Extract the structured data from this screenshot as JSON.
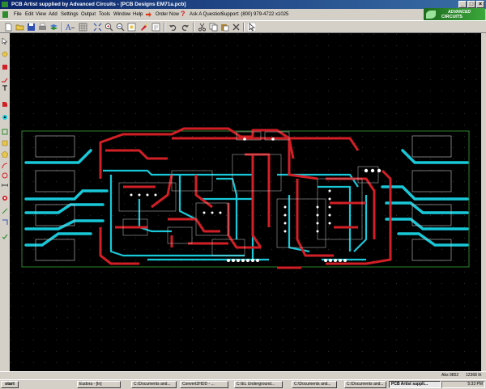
{
  "window": {
    "title": "PCB Artist supplied by Advanced Circuits - [PCB Designs EM71a.pcb]"
  },
  "menubar": {
    "items": [
      {
        "id": "file",
        "label": "File"
      },
      {
        "id": "edit",
        "label": "Edit"
      },
      {
        "id": "view",
        "label": "View"
      },
      {
        "id": "add",
        "label": "Add"
      },
      {
        "id": "settings",
        "label": "Settings"
      },
      {
        "id": "output",
        "label": "Output"
      },
      {
        "id": "tools",
        "label": "Tools"
      },
      {
        "id": "window",
        "label": "Window"
      },
      {
        "id": "help",
        "label": "Help"
      }
    ],
    "order_now": "Order Now",
    "ask_question": "Ask A Question",
    "support": "Support: (800) 979-4722 x1025"
  },
  "logo": {
    "line1": "ADVANCED",
    "line2": "CIRCUITS"
  },
  "colors": {
    "top_copper": "#d21f26",
    "bottom_copper": "#19c8d8",
    "silkscreen": "#c8c8c8",
    "board_outline": "#3aa53a",
    "canvas": "#000000"
  },
  "status": {
    "coords": "Abs 9852",
    "units": "12368 th"
  },
  "taskbar": {
    "start": "start",
    "tasks": [
      {
        "label": "Eudora - [In]"
      },
      {
        "label": "C:\\Documents and..."
      },
      {
        "label": "Convert2HDD - ..."
      },
      {
        "label": "C:\\EL Underground..."
      },
      {
        "label": "C:\\Documents and..."
      },
      {
        "label": "C:\\Documents and..."
      },
      {
        "label": "PCB Artist suppli..."
      }
    ],
    "clock": "5:33 PM"
  }
}
